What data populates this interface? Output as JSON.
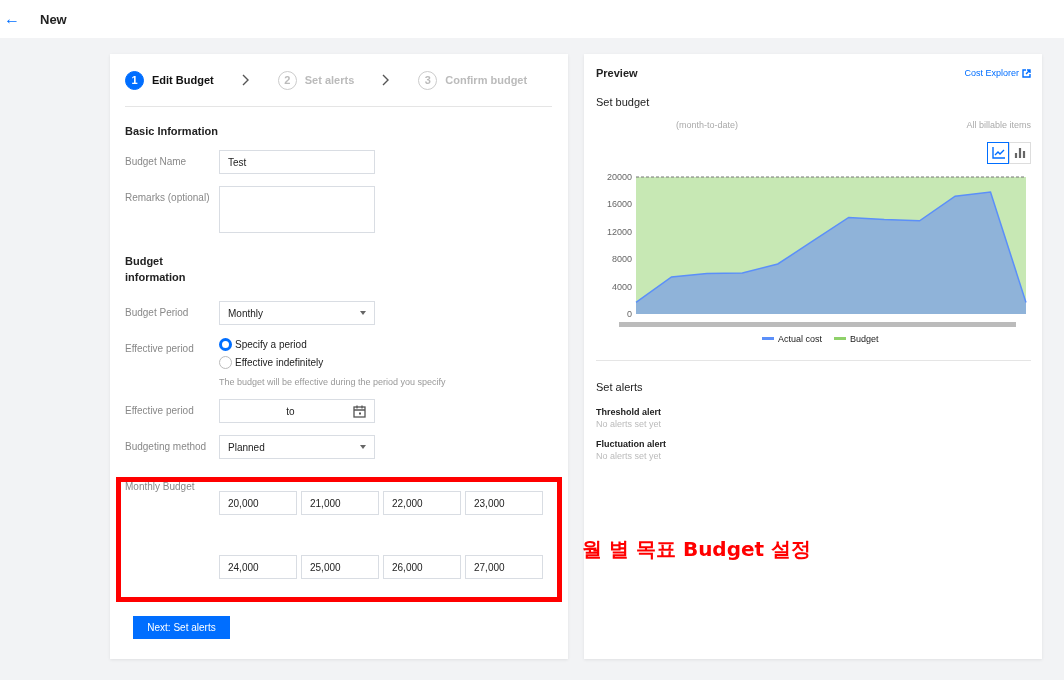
{
  "header": {
    "back": "←",
    "title": "New"
  },
  "steps": [
    {
      "number": "1",
      "label": "Edit Budget",
      "selected": true
    },
    {
      "number": "2",
      "label": "Set alerts",
      "selected": false
    },
    {
      "number": "3",
      "label": "Confirm budget",
      "selected": false
    }
  ],
  "basic": {
    "title": "Basic Information",
    "name_label": "Budget Name",
    "name_value": "Test",
    "remarks_label": "Remarks (optional)"
  },
  "budget_info": {
    "title": "Budget information",
    "period_label": "Budget Period",
    "period_value": "Monthly",
    "effective_label": "Effective period",
    "effective_options": [
      {
        "label": "Specify a period",
        "selected": true
      },
      {
        "label": "Effective indefinitely",
        "selected": false
      }
    ],
    "effective_hint": "The budget will be effective during the period you specify",
    "range_label": "Effective period",
    "range_separator": "to",
    "method_label": "Budgeting method",
    "method_value": "Planned",
    "monthly_label": "Monthly Budget",
    "monthly_values": [
      "20,000",
      "21,000",
      "22,000",
      "23,000",
      "24,000",
      "25,000",
      "26,000",
      "27,000"
    ]
  },
  "next_button": "Next: Set alerts",
  "preview": {
    "title": "Preview",
    "link": "Cost Explorer",
    "set_budget": "Set budget",
    "left_note": "(month-to-date)",
    "right_note": "All billable items",
    "view_toggle": [
      {
        "kind": "line",
        "selected": true
      },
      {
        "kind": "bar",
        "selected": false
      }
    ],
    "chart_data": {
      "type": "area",
      "legend": "bottom",
      "categories": [
        null,
        null,
        null,
        null,
        null,
        null,
        null,
        null,
        null,
        null,
        null,
        null
      ],
      "yticks": [
        0,
        4000,
        8000,
        12000,
        16000,
        20000
      ],
      "ylim": [
        0,
        20000
      ],
      "series": [
        {
          "name": "Actual cost",
          "color": "#5b8ff9",
          "values": [
            1700,
            5400,
            5900,
            6000,
            7300,
            10700,
            14100,
            13800,
            13600,
            17200,
            17800,
            1700
          ]
        },
        {
          "name": "Budget",
          "color": "#8fd16a",
          "values": [
            20000,
            20000,
            20000,
            20000,
            20000,
            20000,
            20000,
            20000,
            20000,
            20000,
            20000,
            20000
          ]
        }
      ]
    },
    "alerts_title": "Set alerts",
    "alerts": [
      {
        "title": "Threshold alert",
        "status": "No alerts set yet"
      },
      {
        "title": "Fluctuation alert",
        "status": "No alerts set yet"
      }
    ]
  },
  "annotation": {
    "text": "월 별 목표 Budget 설정"
  }
}
